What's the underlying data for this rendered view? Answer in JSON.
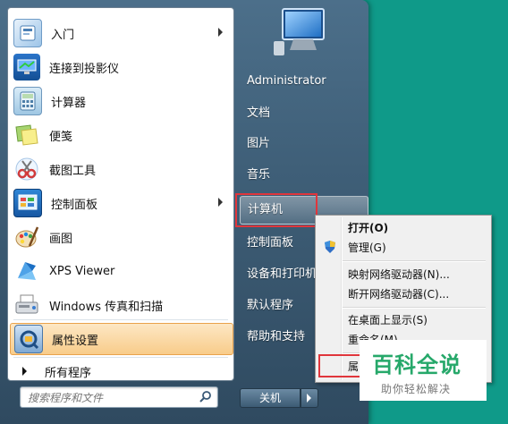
{
  "left_programs": [
    {
      "label": "入门",
      "icon": "getting-started-icon",
      "has_submenu": true
    },
    {
      "label": "连接到投影仪",
      "icon": "projector-icon",
      "has_submenu": false
    },
    {
      "label": "计算器",
      "icon": "calculator-icon",
      "has_submenu": false
    },
    {
      "label": "便笺",
      "icon": "sticky-notes-icon",
      "has_submenu": false
    },
    {
      "label": "截图工具",
      "icon": "snipping-tool-icon",
      "has_submenu": false
    },
    {
      "label": "控制面板",
      "icon": "control-panel-icon",
      "has_submenu": true
    },
    {
      "label": "画图",
      "icon": "paint-icon",
      "has_submenu": false
    },
    {
      "label": "XPS Viewer",
      "icon": "xps-viewer-icon",
      "has_submenu": false
    },
    {
      "label": "Windows 传真和扫描",
      "icon": "fax-scan-icon",
      "has_submenu": false
    },
    {
      "label": "属性设置",
      "icon": "property-settings-icon",
      "has_submenu": false
    }
  ],
  "all_programs": "所有程序",
  "search": {
    "placeholder": "搜索程序和文件"
  },
  "right_items": {
    "user": "Administrator",
    "documents": "文档",
    "pictures": "图片",
    "music": "音乐",
    "computer": "计算机",
    "control_panel": "控制面板",
    "devices_printers": "设备和打印机",
    "default_programs": "默认程序",
    "help_support": "帮助和支持"
  },
  "shutdown": {
    "label": "关机"
  },
  "context_menu": {
    "open": "打开(O)",
    "manage": "管理(G)",
    "map_drive": "映射网络驱动器(N)...",
    "disconnect_drive": "断开网络驱动器(C)...",
    "show_desktop": "在桌面上显示(S)",
    "rename": "重命名(M)",
    "properties": "属"
  },
  "watermark": {
    "title": "百科全说",
    "subtitle": "助你轻松解决"
  },
  "colors": {
    "desktop": "#0f9a89",
    "highlight_border": "#e0363c",
    "watermark_green": "#26a86a"
  }
}
